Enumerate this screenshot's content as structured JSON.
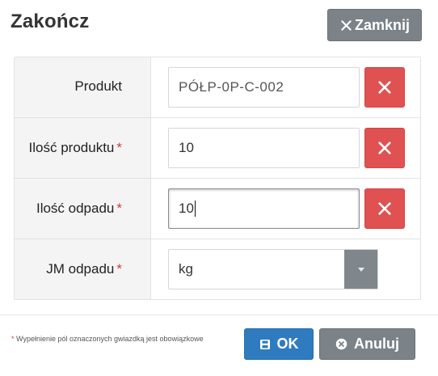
{
  "dialog": {
    "title": "Zakończ",
    "close_label": "Zamknij"
  },
  "fields": [
    {
      "label": "Produkt",
      "required": false,
      "value": "PÓŁP-0P-C-002"
    },
    {
      "label": "Ilość produktu",
      "required": true,
      "value": "10"
    },
    {
      "label": "Ilość odpadu",
      "required": true,
      "value": "10"
    },
    {
      "label": "JM odpadu",
      "required": true,
      "value": "kg"
    }
  ],
  "required_mark": "*",
  "footer": {
    "note": "Wypełnienie pól oznaczonych gwiazdką jest obowiązkowe",
    "ok_label": "OK",
    "cancel_label": "Anuluj"
  },
  "colors": {
    "close_button": "#7b8288",
    "clear_button": "#e05252",
    "ok_button": "#2f7bbf",
    "required": "#d43a3a"
  },
  "icons": {
    "close": "x-icon",
    "clear": "x-icon",
    "ok": "save-icon",
    "cancel": "circle-x-icon",
    "select": "caret-down-icon"
  }
}
